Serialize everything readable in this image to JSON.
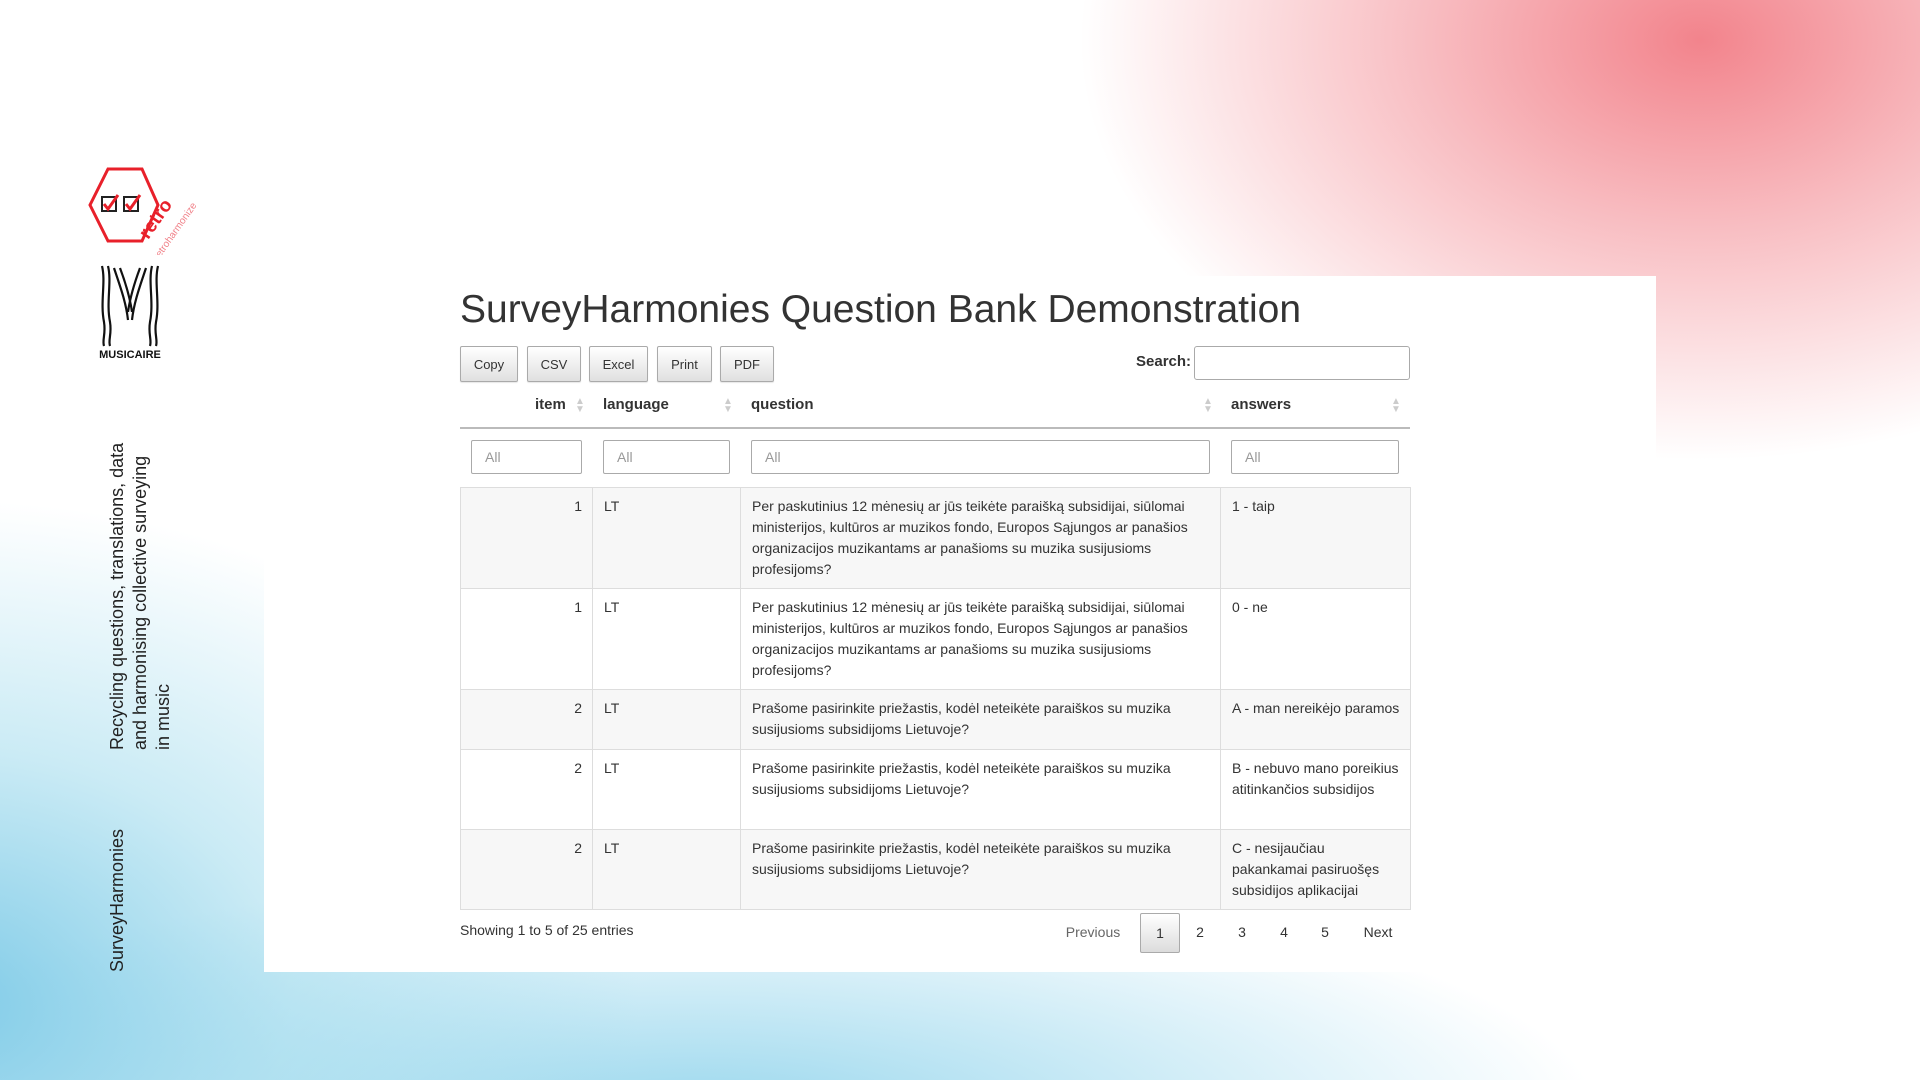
{
  "sidebar": {
    "logo_text": "retro",
    "logo_subtext": "retroharmonize",
    "musicaire_text": "MUSICAIRE",
    "tagline_lines": [
      "Recycling questions, translations, data",
      "and harmonising collective surveying",
      "in music"
    ],
    "brand": "SurveyHarmonies"
  },
  "page": {
    "title": "SurveyHarmonies Question Bank Demonstration"
  },
  "toolbar": {
    "copy": "Copy",
    "csv": "CSV",
    "excel": "Excel",
    "print": "Print",
    "pdf": "PDF",
    "search_label": "Search:",
    "search_value": ""
  },
  "table": {
    "headers": {
      "item": "item",
      "language": "language",
      "question": "question",
      "answers": "answers"
    },
    "filter_placeholder": "All",
    "rows": [
      {
        "item": "1",
        "language": "LT",
        "question": "Per paskutinius 12 mėnesių ar jūs teikėte paraišką subsidijai, siūlomai ministerijos, kultūros ar muzikos fondo, Europos Sąjungos ar panašios organizacijos muzikantams ar panašioms su muzika susijusioms profesijoms?",
        "answers": "1 - taip"
      },
      {
        "item": "1",
        "language": "LT",
        "question": "Per paskutinius 12 mėnesių ar jūs teikėte paraišką subsidijai, siūlomai ministerijos, kultūros ar muzikos fondo, Europos Sąjungos ar panašios organizacijos muzikantams ar panašioms su muzika susijusioms profesijoms?",
        "answers": "0 - ne"
      },
      {
        "item": "2",
        "language": "LT",
        "question": "Prašome pasirinkite priežastis, kodėl neteikėte paraiškos su muzika susijusioms subsidijoms Lietuvoje?",
        "answers": "A - man nereikėjo paramos"
      },
      {
        "item": "2",
        "language": "LT",
        "question": "Prašome pasirinkite priežastis, kodėl neteikėte paraiškos su muzika susijusioms subsidijoms Lietuvoje?",
        "answers": "B - nebuvo mano poreikius atitinkančios subsidijos"
      },
      {
        "item": "2",
        "language": "LT",
        "question": "Prašome pasirinkite priežastis, kodėl neteikėte paraiškos su muzika susijusioms subsidijoms Lietuvoje?",
        "answers": "C - nesijaučiau pakankamai pasiruošęs subsidijos aplikacijai"
      }
    ]
  },
  "footer": {
    "info": "Showing 1 to 5 of 25 entries",
    "previous": "Previous",
    "pages": [
      "1",
      "2",
      "3",
      "4",
      "5"
    ],
    "current_page": "1",
    "next": "Next"
  },
  "colors": {
    "logo_red": "#e8202a",
    "accent_pink": "#f07a84",
    "accent_blue": "#8cd2eb"
  },
  "icons": [
    "checkbox-icon",
    "sort-icon"
  ]
}
